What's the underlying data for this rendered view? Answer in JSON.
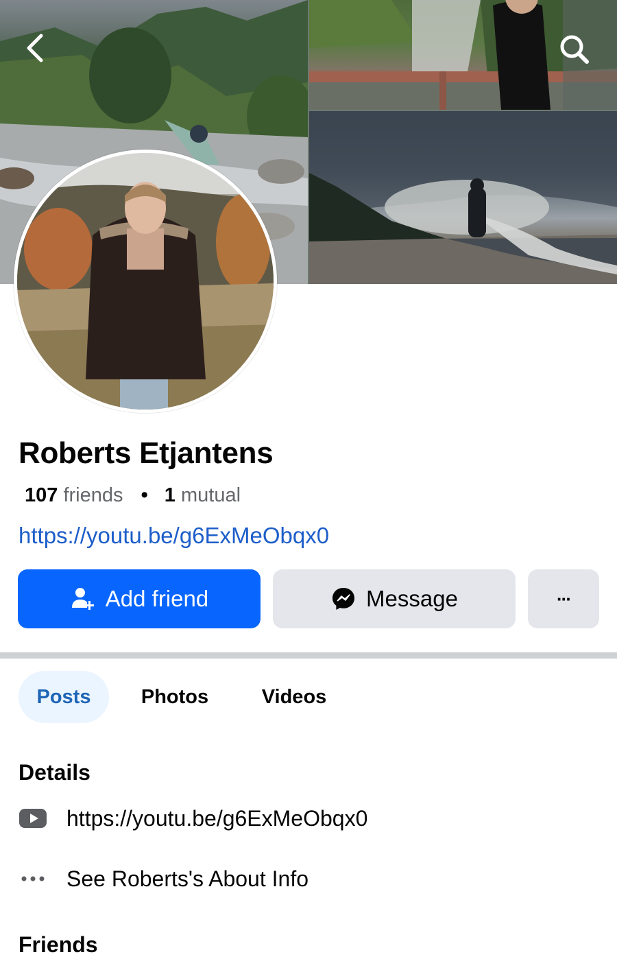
{
  "cover": {
    "icons": [
      "back-arrow-icon",
      "search-icon"
    ]
  },
  "profile": {
    "name": "Roberts Etjantens",
    "friends_count": "107",
    "friends_label": "friends",
    "separator": "•",
    "mutual_count": "1",
    "mutual_label": "mutual",
    "link": "https://youtu.be/g6ExMeObqx0"
  },
  "actions": {
    "add_friend_label": "Add friend",
    "message_label": "Message",
    "more_label": "···"
  },
  "tabs": [
    {
      "label": "Posts",
      "active": true
    },
    {
      "label": "Photos",
      "active": false
    },
    {
      "label": "Videos",
      "active": false
    }
  ],
  "details": {
    "title": "Details",
    "items": [
      {
        "icon": "youtube-icon",
        "text": "https://youtu.be/g6ExMeObqx0"
      },
      {
        "icon": "more-dots-icon",
        "text": "See Roberts's About Info"
      }
    ]
  },
  "friends": {
    "title": "Friends"
  },
  "colors": {
    "primary_blue": "#0866ff",
    "link_blue": "#1d5ec9",
    "secondary_button": "#e4e6eb",
    "active_tab_bg": "#ebf5ff",
    "active_tab_text": "#1e65b6",
    "secondary_text": "#65676b"
  }
}
